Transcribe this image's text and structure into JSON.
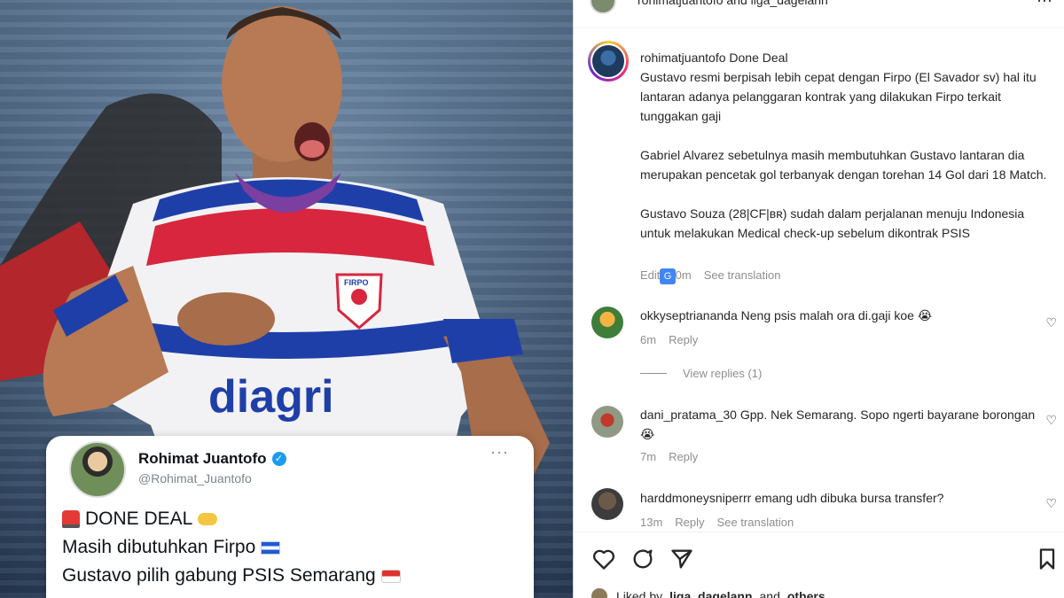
{
  "post": {
    "header_text": "rohimatjuantofo and liga_dagelann",
    "more_label": "···"
  },
  "tweet": {
    "name": "Rohimat Juantofo",
    "verified_mark": "✓",
    "handle": "@Rohimat_Juantofo",
    "more_label": "···",
    "line1": "DONE DEAL",
    "line2": "Masih dibutuhkan Firpo",
    "line3": "Gustavo pilih gabung PSIS Semarang",
    "jersey_sponsor": "diagri",
    "jersey_crest": "FIRPO"
  },
  "caption": {
    "username": "rohimatjuantofo",
    "title": "Done Deal",
    "para1": "Gustavo resmi berpisah lebih cepat dengan Firpo (El Savador sv) hal itu lantaran adanya pelanggaran kontrak yang dilakukan Firpo terkait tunggakan gaji",
    "para2": "Gabriel Alvarez sebetulnya masih membutuhkan Gustavo lantaran dia merupakan pencetak gol terbanyak dengan torehan 14 Gol dari 18 Match.",
    "para3": "Gustavo Souza (28|CF|ʙʀ) sudah dalam perjalanan menuju Indonesia untuk melakukan Medical check-up sebelum dikontrak PSIS",
    "edit_label": "Edit",
    "time": "0m",
    "translate_icon_label": "G",
    "see_translation": "See translation"
  },
  "comments": [
    {
      "username": "okkyseptriananda",
      "text": "Neng psis malah ora di.gaji koe 😭",
      "time": "6m",
      "reply": "Reply"
    },
    {
      "username": "dani_pratama_30",
      "text": "Gpp. Nek Semarang. Sopo ngerti bayarane borongan 😭",
      "time": "7m",
      "reply": "Reply"
    },
    {
      "username": "harddmoneysniperrr",
      "text": "emang udh dibuka bursa transfer?",
      "time": "13m",
      "reply": "Reply",
      "see_translation": "See translation"
    }
  ],
  "view_replies": "View replies (1)",
  "liked_by": {
    "prefix": "Liked by",
    "user": "liga_dagelann",
    "joiner": "and",
    "others": "others"
  },
  "icons": {
    "like": "heart-icon",
    "comment": "comment-icon",
    "share": "send-icon",
    "save": "bookmark-icon"
  },
  "colors": {
    "accent_blue": "#1d9bf0",
    "jersey_red": "#d7263d",
    "jersey_blue": "#1f3fa8"
  }
}
